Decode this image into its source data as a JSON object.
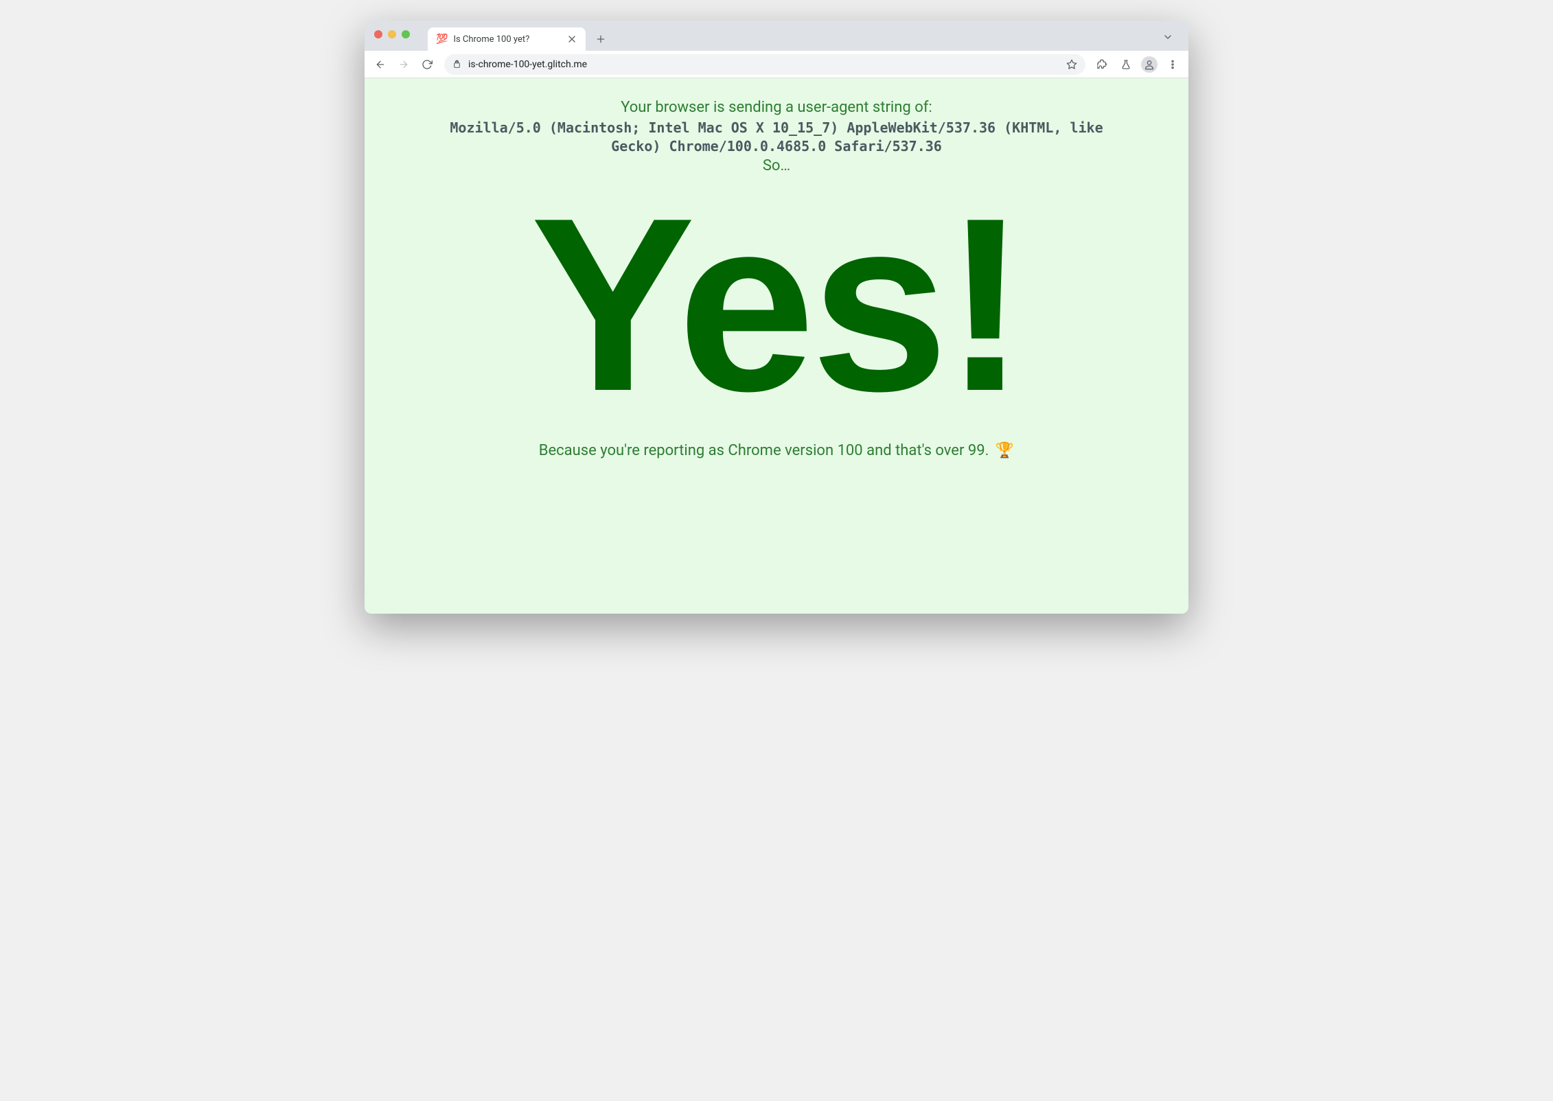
{
  "window": {
    "tab": {
      "favicon": "💯",
      "title": "Is Chrome 100 yet?"
    }
  },
  "toolbar": {
    "url": "is-chrome-100-yet.glitch.me"
  },
  "page": {
    "heading": "Your browser is sending a user-agent string of:",
    "ua_string": "Mozilla/5.0 (Macintosh; Intel Mac OS X 10_15_7) AppleWebKit/537.36 (KHTML, like Gecko) Chrome/100.0.4685.0 Safari/537.36",
    "so": "So…",
    "answer": "Yes!",
    "because": "Because you're reporting as Chrome version 100 and that's over 99.",
    "trophy": "🏆"
  }
}
